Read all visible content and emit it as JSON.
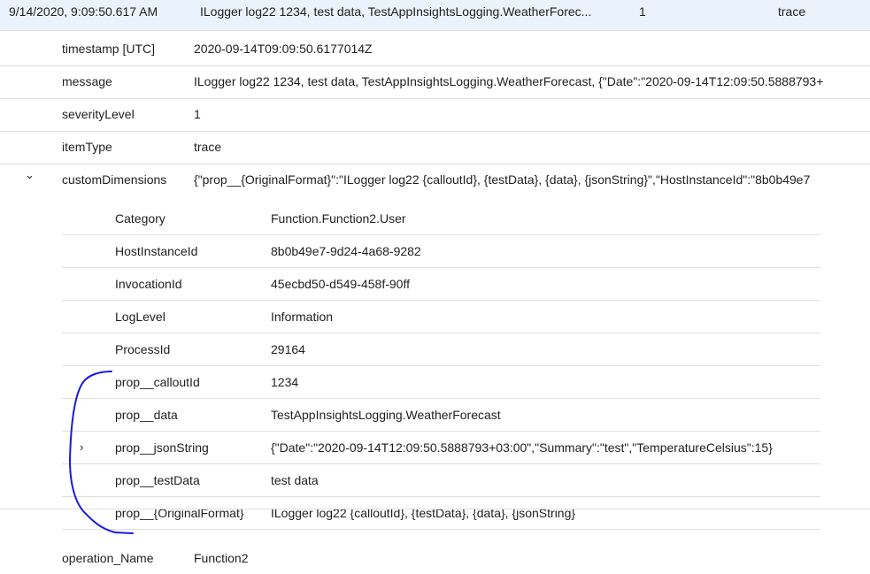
{
  "summary_row": {
    "time": "9/14/2020, 9:09:50.617 AM",
    "message": "ILogger log22 1234, test data, TestAppInsightsLogging.WeatherForec...",
    "severity": "1",
    "itemType": "trace"
  },
  "fields": [
    {
      "key": "timestamp [UTC]",
      "value": "2020-09-14T09:09:50.6177014Z"
    },
    {
      "key": "message",
      "value": "ILogger log22 1234, test data, TestAppInsightsLogging.WeatherForecast, {\"Date\":\"2020-09-14T12:09:50.5888793+"
    },
    {
      "key": "severityLevel",
      "value": "1"
    },
    {
      "key": "itemType",
      "value": "trace"
    },
    {
      "key": "customDimensions",
      "value": "{\"prop__{OriginalFormat}\":\"ILogger log22 {calloutId}, {testData}, {data}, {jsonString}\",\"HostInstanceId\":\"8b0b49e7"
    }
  ],
  "custom_dimensions": [
    {
      "key": "Category",
      "value": "Function.Function2.User"
    },
    {
      "key": "HostInstanceId",
      "value": "8b0b49e7-9d24-4a68-9282"
    },
    {
      "key": "InvocationId",
      "value": "45ecbd50-d549-458f-90ff"
    },
    {
      "key": "LogLevel",
      "value": "Information"
    },
    {
      "key": "ProcessId",
      "value": "29164"
    },
    {
      "key": "prop__calloutId",
      "value": "1234"
    },
    {
      "key": "prop__data",
      "value": "TestAppInsightsLogging.WeatherForecast"
    },
    {
      "key": "prop__jsonString",
      "value": "{\"Date\":\"2020-09-14T12:09:50.5888793+03:00\",\"Summary\":\"test\",\"TemperatureCelsius\":15}"
    },
    {
      "key": "prop__testData",
      "value": "test data"
    },
    {
      "key": "prop__{OriginalFormat}",
      "value": "ILogger log22 {calloutId}, {testData}, {data}, {jsonString}"
    }
  ],
  "after": {
    "key": "operation_Name",
    "value": "Function2"
  },
  "icons": {
    "expanded": "⌄",
    "collapsed": "›"
  },
  "colors": {
    "annotation": "#1a1adb",
    "selected_row": "#eaf2fb"
  }
}
